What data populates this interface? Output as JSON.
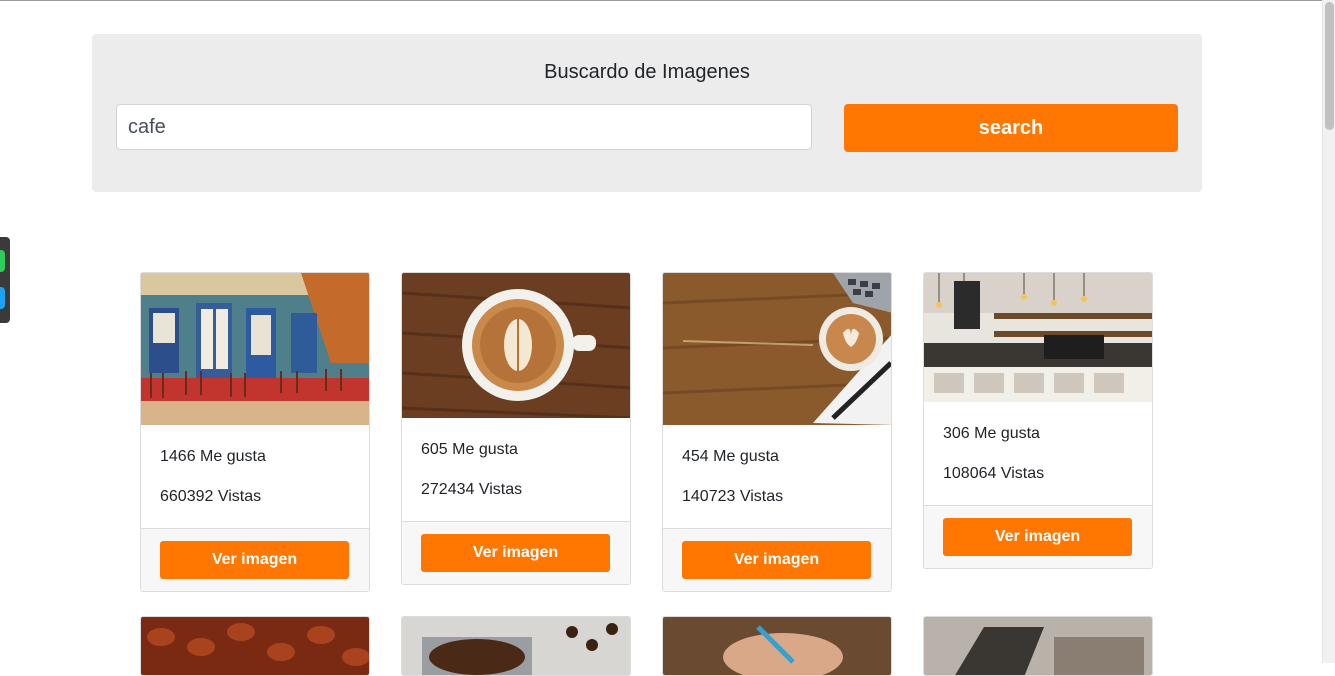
{
  "search": {
    "title": "Buscardo de Imagenes",
    "query_value": "cafe",
    "button_label": "search"
  },
  "results": [
    {
      "likes": "1466 Me gusta",
      "views": "660392 Vistas",
      "button": "Ver imagen",
      "image": "cafe-storefront"
    },
    {
      "likes": "605 Me gusta",
      "views": "272434 Vistas",
      "button": "Ver imagen",
      "image": "latte-cup"
    },
    {
      "likes": "454 Me gusta",
      "views": "140723 Vistas",
      "button": "Ver imagen",
      "image": "latte-desk"
    },
    {
      "likes": "306 Me gusta",
      "views": "108064 Vistas",
      "button": "Ver imagen",
      "image": "coffee-shop-interior"
    }
  ],
  "colors": {
    "accent": "#ff7700",
    "panel_bg": "#ececec"
  }
}
